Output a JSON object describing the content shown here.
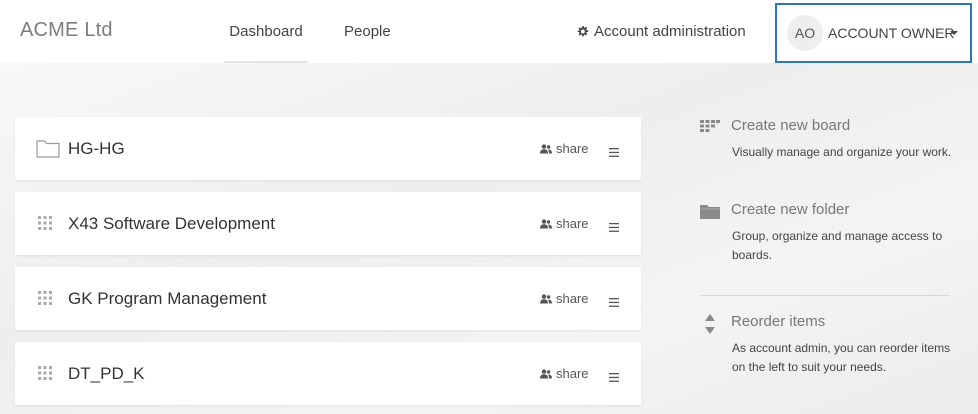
{
  "header": {
    "brand": "ACME Ltd",
    "nav": [
      {
        "label": "Dashboard",
        "active": true
      },
      {
        "label": "People",
        "active": false
      }
    ],
    "account_admin_label": "Account administration",
    "account_admin_icon": "gear-icon",
    "user": {
      "initials": "AO",
      "label": "ACCOUNT OWNER"
    }
  },
  "boards": [
    {
      "title": "HG-HG",
      "icon": "folder-icon",
      "share_label": "share"
    },
    {
      "title": "X43 Software Development",
      "icon": "drag-handle-icon",
      "share_label": "share"
    },
    {
      "title": "GK Program Management",
      "icon": "drag-handle-icon",
      "share_label": "share"
    },
    {
      "title": "DT_PD_K",
      "icon": "drag-handle-icon",
      "share_label": "share"
    }
  ],
  "panel": {
    "create_board": {
      "title": "Create new board",
      "description": "Visually manage and organize your work.",
      "icon": "board-icon"
    },
    "create_folder": {
      "title": "Create new folder",
      "description": "Group, organize and manage access to boards.",
      "icon": "folder-filled-icon"
    },
    "reorder": {
      "title": "Reorder items",
      "description": "As account admin, you can reorder items on the left to suit your needs.",
      "icon": "sort-arrows-icon"
    }
  },
  "colors": {
    "accent_border": "#2f74b5",
    "background": "#f3f3f3",
    "card": "#ffffff"
  }
}
